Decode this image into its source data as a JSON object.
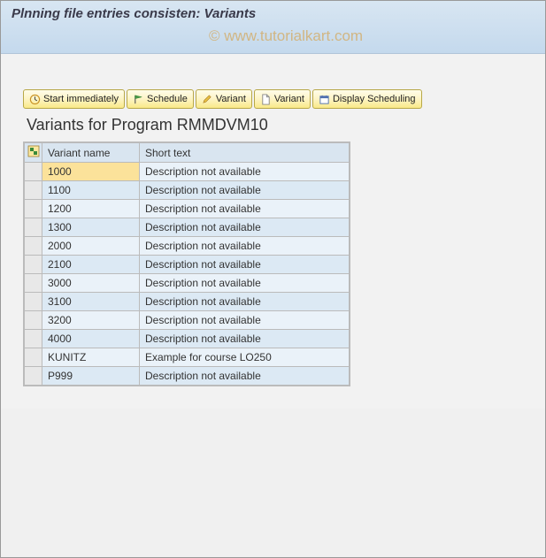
{
  "title": "Plnning file entries consisten: Variants",
  "watermark": "© www.tutorialkart.com",
  "toolbar": {
    "start_immediately": "Start immediately",
    "schedule": "Schedule",
    "variant1": "Variant",
    "variant2": "Variant",
    "display_scheduling": "Display Scheduling"
  },
  "section_title": "Variants for Program RMMDVM10",
  "table": {
    "headers": {
      "variant_name": "Variant name",
      "short_text": "Short text"
    },
    "rows": [
      {
        "variant": "1000",
        "short": "Description not available",
        "highlight": true
      },
      {
        "variant": "1100",
        "short": "Description not available"
      },
      {
        "variant": "1200",
        "short": "Description not available"
      },
      {
        "variant": "1300",
        "short": "Description not available"
      },
      {
        "variant": "2000",
        "short": "Description not available"
      },
      {
        "variant": "2100",
        "short": "Description not available"
      },
      {
        "variant": "3000",
        "short": "Description not available"
      },
      {
        "variant": "3100",
        "short": "Description not available"
      },
      {
        "variant": "3200",
        "short": "Description not available"
      },
      {
        "variant": "4000",
        "short": "Description not available"
      },
      {
        "variant": "KUNITZ",
        "short": "Example for course LO250"
      },
      {
        "variant": "P999",
        "short": "Description not available"
      }
    ]
  }
}
